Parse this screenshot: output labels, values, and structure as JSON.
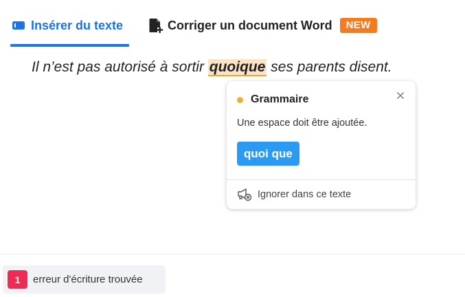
{
  "tabs": {
    "insert_label": "Insérer du texte",
    "word_label": "Corriger un document Word",
    "new_badge": "NEW"
  },
  "sentence": {
    "before": "Il n’est pas autorisé à sortir ",
    "error": "quoique",
    "after": " ses parents disent."
  },
  "popup": {
    "category": "Grammaire",
    "message": "Une espace doit être ajoutée.",
    "suggestion": "quoi que",
    "ignore_label": "Ignorer dans ce texte"
  },
  "footer": {
    "count": "1",
    "label": "erreur d'écriture trouvée"
  },
  "colors": {
    "accent": "#1a73e8",
    "new_badge": "#f47b20",
    "warning_dot": "#f0ad3e",
    "suggestion_button": "#2b9af3",
    "error_badge": "#ef2b55"
  },
  "icons": {
    "insert_tab": "keyboard-icon",
    "word_tab": "document-add-icon",
    "close": "close-icon",
    "ignore": "megaphone-mute-icon"
  }
}
